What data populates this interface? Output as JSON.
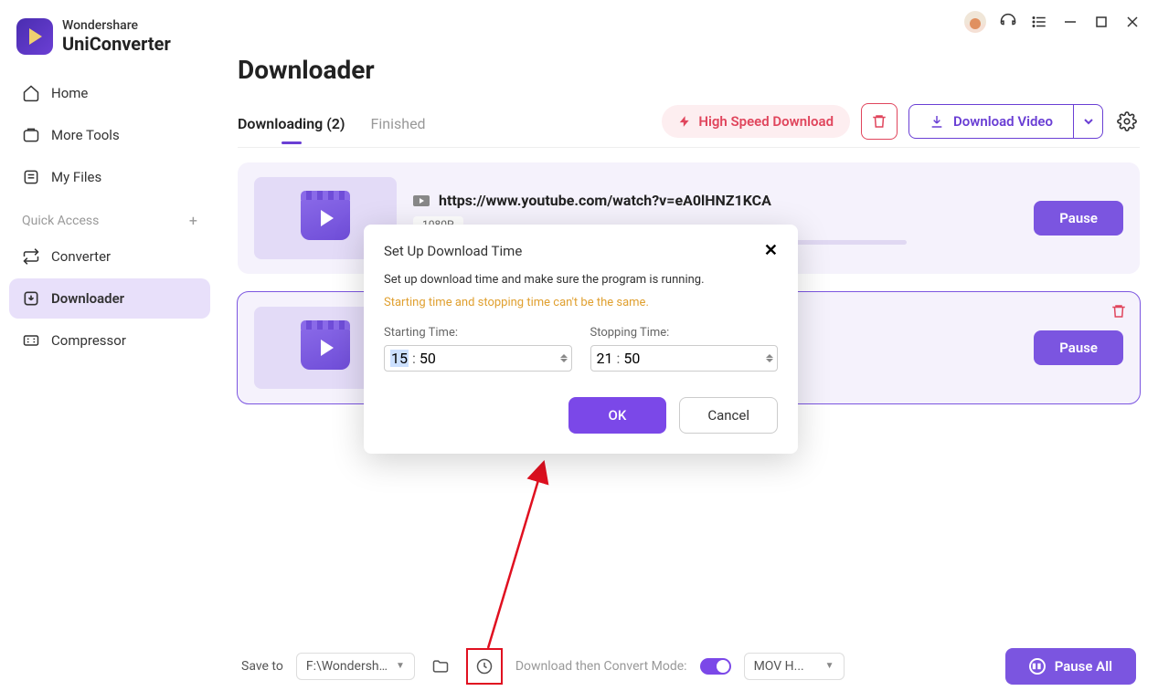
{
  "app": {
    "brand_top": "Wondershare",
    "brand_bottom": "UniConverter"
  },
  "sidebar": {
    "items": [
      {
        "label": "Home"
      },
      {
        "label": "More Tools"
      },
      {
        "label": "My Files"
      }
    ],
    "quick_label": "Quick Access",
    "quick": [
      {
        "label": "Converter"
      },
      {
        "label": "Downloader"
      },
      {
        "label": "Compressor"
      }
    ]
  },
  "page": {
    "title": "Downloader",
    "tabs": {
      "downloading": "Downloading (2)",
      "finished": "Finished"
    },
    "high_speed": "High Speed Download",
    "download_video": "Download Video"
  },
  "cards": [
    {
      "url": "https://www.youtube.com/watch?v=eA0lHNZ1KCA",
      "quality": "1080P",
      "pause": "Pause"
    },
    {
      "url": "",
      "quality": "",
      "pause": "Pause"
    }
  ],
  "modal": {
    "title": "Set Up Download Time",
    "desc": "Set up download time and make sure the program is running.",
    "warn": "Starting time and stopping time can't be the same.",
    "start_label": "Starting Time:",
    "stop_label": "Stopping Time:",
    "start_h": "15",
    "start_m": "50",
    "stop_h": "21",
    "stop_m": "50",
    "ok": "OK",
    "cancel": "Cancel"
  },
  "footer": {
    "save_to": "Save to",
    "path": "F:\\Wondershare U",
    "convert_label": "Download then Convert Mode:",
    "format": "MOV H...",
    "pause_all": "Pause All"
  }
}
